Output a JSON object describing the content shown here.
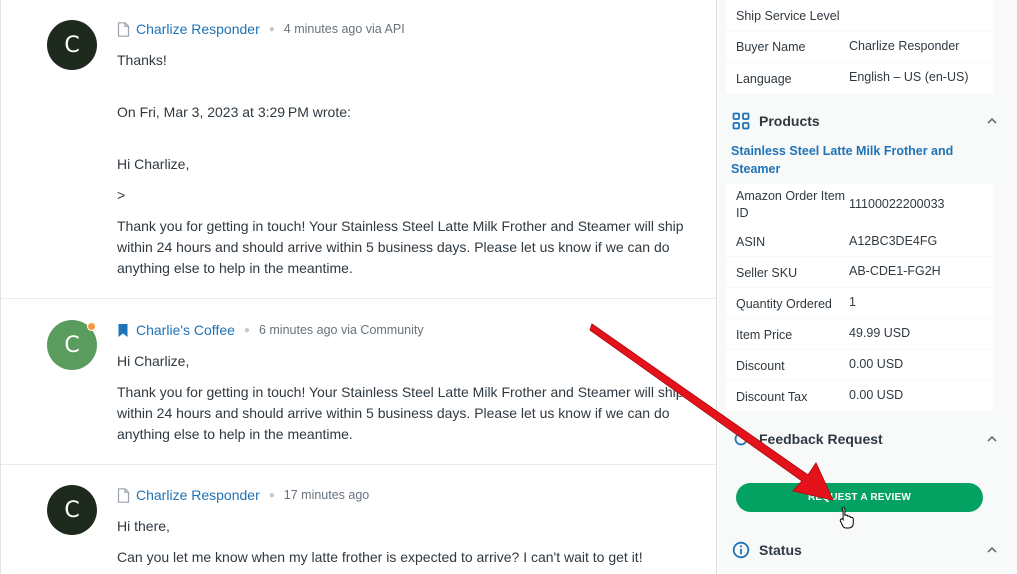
{
  "conversation": {
    "messages": [
      {
        "avatar_initial": "C",
        "author": "Charlize Responder",
        "time": "4 minutes ago via API",
        "lines": [
          "Thanks!",
          "On Fri, Mar 3, 2023 at 3:29 PM wrote:",
          "Hi Charlize,",
          ">",
          "Thank you for getting in touch! Your Stainless Steel Latte Milk Frother and Steamer will ship",
          "within 24 hours and should arrive within 5 business days. Please let us know if we can do",
          "anything else to help in the meantime."
        ]
      },
      {
        "avatar_initial": "C",
        "author": "Charlie's Coffee",
        "time": "6 minutes ago via Community",
        "lines": [
          "Hi Charlize,",
          "Thank you for getting in touch! Your Stainless Steel Latte Milk Frother and Steamer will ship",
          "within 24 hours and should arrive within 5 business days. Please let us know if we can do",
          "anything else to help in the meantime."
        ]
      },
      {
        "avatar_initial": "C",
        "author": "Charlize Responder",
        "time": "17 minutes ago",
        "lines": [
          "Hi there,",
          "Can you let me know when my latte frother is expected to arrive? I can't wait to get it!"
        ]
      }
    ]
  },
  "side_panel": {
    "order_fields": [
      {
        "key": "Ship Service Level",
        "value": ""
      },
      {
        "key": "Buyer Name",
        "value": "Charlize Responder"
      },
      {
        "key": "Language",
        "value": "English – US (en-US)"
      }
    ],
    "products_header": "Products",
    "product_name": "Stainless Steel Latte Milk Frother and Steamer",
    "product_fields": [
      {
        "key": "Amazon Order Item ID",
        "value": "11100022200033"
      },
      {
        "key": "ASIN",
        "value": "A12BC3DE4FG"
      },
      {
        "key": "Seller SKU",
        "value": "AB-CDE1-FG2H"
      },
      {
        "key": "Quantity Ordered",
        "value": "1"
      },
      {
        "key": "Item Price",
        "value": "49.99 USD"
      },
      {
        "key": "Discount",
        "value": "0.00 USD"
      },
      {
        "key": "Discount Tax",
        "value": "0.00 USD"
      }
    ],
    "feedback_header": "Feedback Request",
    "request_review_label": "REQUEST A REVIEW",
    "status_header": "Status"
  },
  "colors": {
    "link": "#1f73b7",
    "button": "#03a262",
    "annotation_arrow": "#e3121b",
    "presence": "#f79a3e"
  },
  "icons": {
    "api_message": "document-icon",
    "agent_message": "bookmark-icon",
    "products": "grid-icon",
    "feedback": "refresh-icon",
    "status": "info-icon",
    "collapse": "chevron-up-icon",
    "pointer": "hand-cursor-icon"
  }
}
